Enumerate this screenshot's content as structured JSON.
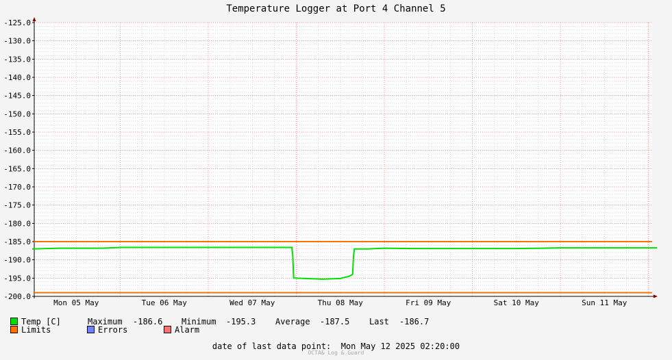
{
  "chart_data": {
    "type": "line",
    "title": "Temperature Logger at Port 4 Channel 5",
    "ylim": [
      -200.0,
      -125.0
    ],
    "yticks": [
      "-125.0",
      "-130.0",
      "-135.0",
      "-140.0",
      "-145.0",
      "-150.0",
      "-155.0",
      "-160.0",
      "-165.0",
      "-170.0",
      "-175.0",
      "-180.0",
      "-185.0",
      "-190.0",
      "-195.0",
      "-200.0"
    ],
    "xlim": [
      0,
      7.1
    ],
    "xticks": [
      {
        "label": "Mon 05 May",
        "day": 0
      },
      {
        "label": "Tue 06 May",
        "day": 1
      },
      {
        "label": "Wed 07 May",
        "day": 2
      },
      {
        "label": "Thu 08 May",
        "day": 3
      },
      {
        "label": "Fri 09 May",
        "day": 4
      },
      {
        "label": "Sat 10 May",
        "day": 5
      },
      {
        "label": "Sun 11 May",
        "day": 6
      }
    ],
    "grid": true,
    "limits": [
      -185.0,
      -199.0
    ],
    "series": [
      {
        "name": "Temp [C]",
        "color": "#00e000",
        "x": [
          0.0,
          0.3,
          0.8,
          1.0,
          1.5,
          2.0,
          2.5,
          2.95,
          2.96,
          2.97,
          2.98,
          3.1,
          3.2,
          3.3,
          3.5,
          3.6,
          3.64,
          3.65,
          3.66,
          3.67,
          3.8,
          4.0,
          4.3,
          4.6,
          5.0,
          5.5,
          5.8,
          6.0,
          6.5,
          7.1
        ],
        "y": [
          -187.0,
          -186.8,
          -186.8,
          -186.6,
          -186.6,
          -186.6,
          -186.6,
          -186.6,
          -189.0,
          -195.0,
          -195.0,
          -195.1,
          -195.2,
          -195.3,
          -195.1,
          -194.5,
          -194.0,
          -189.0,
          -187.0,
          -187.0,
          -187.0,
          -186.8,
          -186.9,
          -186.9,
          -186.9,
          -186.9,
          -186.8,
          -186.7,
          -186.7,
          -186.7
        ]
      }
    ],
    "stats": {
      "maximum_label": "Maximum",
      "maximum": "-186.6",
      "minimum_label": "Minimum",
      "minimum": "-195.3",
      "average_label": "Average",
      "average": "-187.5",
      "last_label": "Last",
      "last": "-186.7"
    },
    "legend": [
      {
        "name": "Temp [C]",
        "color": "#00e000"
      },
      {
        "name": "Limits",
        "color": "#ff7000"
      },
      {
        "name": "Errors",
        "color": "#7080ff"
      },
      {
        "name": "Alarm",
        "color": "#ff7070"
      }
    ],
    "last_data_point_label": "date of last data point:",
    "last_data_point": "Mon May 12 2025 02:20:00",
    "watermark": "OCTA& Log & Guard"
  }
}
